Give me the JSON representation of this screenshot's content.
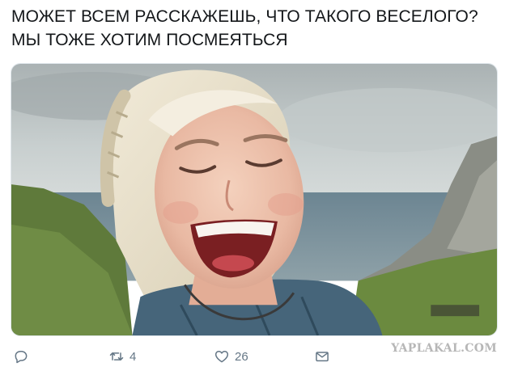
{
  "tweet": {
    "text_lines": [
      "МОЖЕТ ВСЕМ РАССКАЖЕШЬ, ЧТО ТАКОГО ВЕСЕЛОГО?",
      "МЫ ТОЖЕ ХОТИМ ПОСМЕЯТЬСЯ"
    ]
  },
  "media": {
    "description_icon": "photo-laughing-woman"
  },
  "actions": {
    "reply": {
      "icon": "reply-icon",
      "count": ""
    },
    "retweet": {
      "icon": "retweet-icon",
      "count": "4"
    },
    "like": {
      "icon": "heart-icon",
      "count": "26"
    },
    "dm": {
      "icon": "envelope-icon",
      "count": ""
    }
  },
  "watermark": "YAPLAKAL.COM",
  "colors": {
    "text": "#14171a",
    "action_gray": "#657786",
    "watermark": "#b7b7b7"
  }
}
